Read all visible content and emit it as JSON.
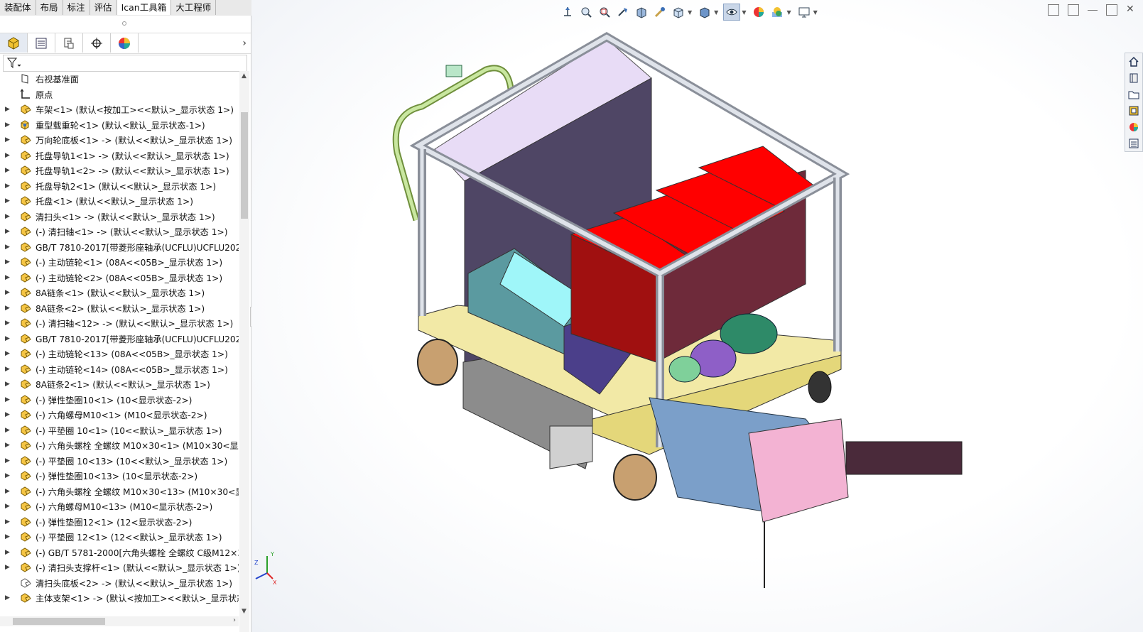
{
  "tabs": [
    "装配体",
    "布局",
    "标注",
    "评估",
    "Ican工具箱",
    "大工程师"
  ],
  "active_tab": 4,
  "panel_tabs": [
    "feature-manager-icon",
    "property-manager-icon",
    "configuration-manager-icon",
    "dimxpert-icon",
    "display-manager-icon"
  ],
  "tree": [
    {
      "icon": "plane",
      "expand": false,
      "label": "右视基准面"
    },
    {
      "icon": "origin",
      "expand": false,
      "label": "原点"
    },
    {
      "icon": "assembly",
      "expand": true,
      "label": "车架<1> (默认<按加工><<默认>_显示状态 1>)"
    },
    {
      "icon": "part",
      "expand": true,
      "label": "重型载重轮<1> (默认<默认_显示状态-1>)"
    },
    {
      "icon": "assembly",
      "expand": true,
      "label": "万向轮底板<1> -> (默认<<默认>_显示状态 1>)"
    },
    {
      "icon": "assembly",
      "expand": true,
      "label": "托盘导轨1<1> -> (默认<<默认>_显示状态 1>)"
    },
    {
      "icon": "assembly",
      "expand": true,
      "label": "托盘导轨1<2> -> (默认<<默认>_显示状态 1>)"
    },
    {
      "icon": "assembly",
      "expand": true,
      "label": "托盘导轨2<1> (默认<<默认>_显示状态 1>)"
    },
    {
      "icon": "assembly",
      "expand": true,
      "label": "托盘<1> (默认<<默认>_显示状态 1>)"
    },
    {
      "icon": "assembly",
      "expand": true,
      "label": "清扫头<1> -> (默认<<默认>_显示状态 1>)"
    },
    {
      "icon": "assembly",
      "expand": true,
      "label": "(-) 清扫轴<1> -> (默认<<默认>_显示状态 1>)"
    },
    {
      "icon": "assembly",
      "expand": true,
      "label": "GB/T 7810-2017[带菱形座轴承(UCFLU)UCFLU202]<"
    },
    {
      "icon": "assembly",
      "expand": true,
      "label": "(-) 主动链轮<1> (08A<<05B>_显示状态 1>)"
    },
    {
      "icon": "assembly",
      "expand": true,
      "label": "(-) 主动链轮<2> (08A<<05B>_显示状态 1>)"
    },
    {
      "icon": "assembly",
      "expand": true,
      "label": "8A链条<1> (默认<<默认>_显示状态 1>)"
    },
    {
      "icon": "assembly",
      "expand": true,
      "label": "8A链条<2> (默认<<默认>_显示状态 1>)"
    },
    {
      "icon": "assembly",
      "expand": true,
      "label": "(-) 清扫轴<12> -> (默认<<默认>_显示状态 1>)"
    },
    {
      "icon": "assembly",
      "expand": true,
      "label": "GB/T 7810-2017[带菱形座轴承(UCFLU)UCFLU202]<"
    },
    {
      "icon": "assembly",
      "expand": true,
      "label": "(-) 主动链轮<13> (08A<<05B>_显示状态 1>)"
    },
    {
      "icon": "assembly",
      "expand": true,
      "label": "(-) 主动链轮<14> (08A<<05B>_显示状态 1>)"
    },
    {
      "icon": "assembly",
      "expand": true,
      "label": "8A链条2<1> (默认<<默认>_显示状态 1>)"
    },
    {
      "icon": "assembly",
      "expand": true,
      "label": "(-) 弹性垫圈10<1> (10<显示状态-2>)"
    },
    {
      "icon": "assembly",
      "expand": true,
      "label": "(-) 六角螺母M10<1> (M10<显示状态-2>)"
    },
    {
      "icon": "assembly",
      "expand": true,
      "label": "(-) 平垫圈 10<1> (10<<默认>_显示状态 1>)"
    },
    {
      "icon": "assembly",
      "expand": true,
      "label": "(-) 六角头螺栓 全螺纹 M10×30<1> (M10×30<显示"
    },
    {
      "icon": "assembly",
      "expand": true,
      "label": "(-) 平垫圈 10<13> (10<<默认>_显示状态 1>)"
    },
    {
      "icon": "assembly",
      "expand": true,
      "label": "(-) 弹性垫圈10<13> (10<显示状态-2>)"
    },
    {
      "icon": "assembly",
      "expand": true,
      "label": "(-) 六角头螺栓 全螺纹 M10×30<13> (M10×30<显示"
    },
    {
      "icon": "assembly",
      "expand": true,
      "label": "(-) 六角螺母M10<13> (M10<显示状态-2>)"
    },
    {
      "icon": "assembly",
      "expand": true,
      "label": "(-) 弹性垫圈12<1> (12<显示状态-2>)"
    },
    {
      "icon": "assembly",
      "expand": true,
      "label": "(-) 平垫圈 12<1> (12<<默认>_显示状态 1>)"
    },
    {
      "icon": "assembly",
      "expand": true,
      "label": "(-) GB/T 5781-2000[六角头螺栓 全螺纹 C级M12×3"
    },
    {
      "icon": "assembly",
      "expand": true,
      "label": "(-) 清扫头支撑杆<1> (默认<<默认>_显示状态 1>)"
    },
    {
      "icon": "assembly-outline",
      "expand": false,
      "label": "清扫头底板<2> -> (默认<<默认>_显示状态 1>)"
    },
    {
      "icon": "assembly",
      "expand": true,
      "label": "主体支架<1> -> (默认<按加工><<默认>_显示状态"
    }
  ],
  "heads_up_toolbar": [
    "view-orientation-icon",
    "zoom-to-fit-icon",
    "zoom-to-area-icon",
    "previous-view-icon",
    "section-view-icon",
    "dynamic-annotation-icon",
    "view-orientation-cube-icon",
    "display-style-icon",
    "hide-show-icon",
    "edit-appearance-icon",
    "apply-scene-icon",
    "view-settings-icon"
  ],
  "triad": {
    "x": "X",
    "y": "Y",
    "z": "Z"
  },
  "colors": {
    "accent": "#c8a24a",
    "red_bins": "#ff0000",
    "frame": "#9aa0aa",
    "yellow_base": "#f2e9a6"
  }
}
